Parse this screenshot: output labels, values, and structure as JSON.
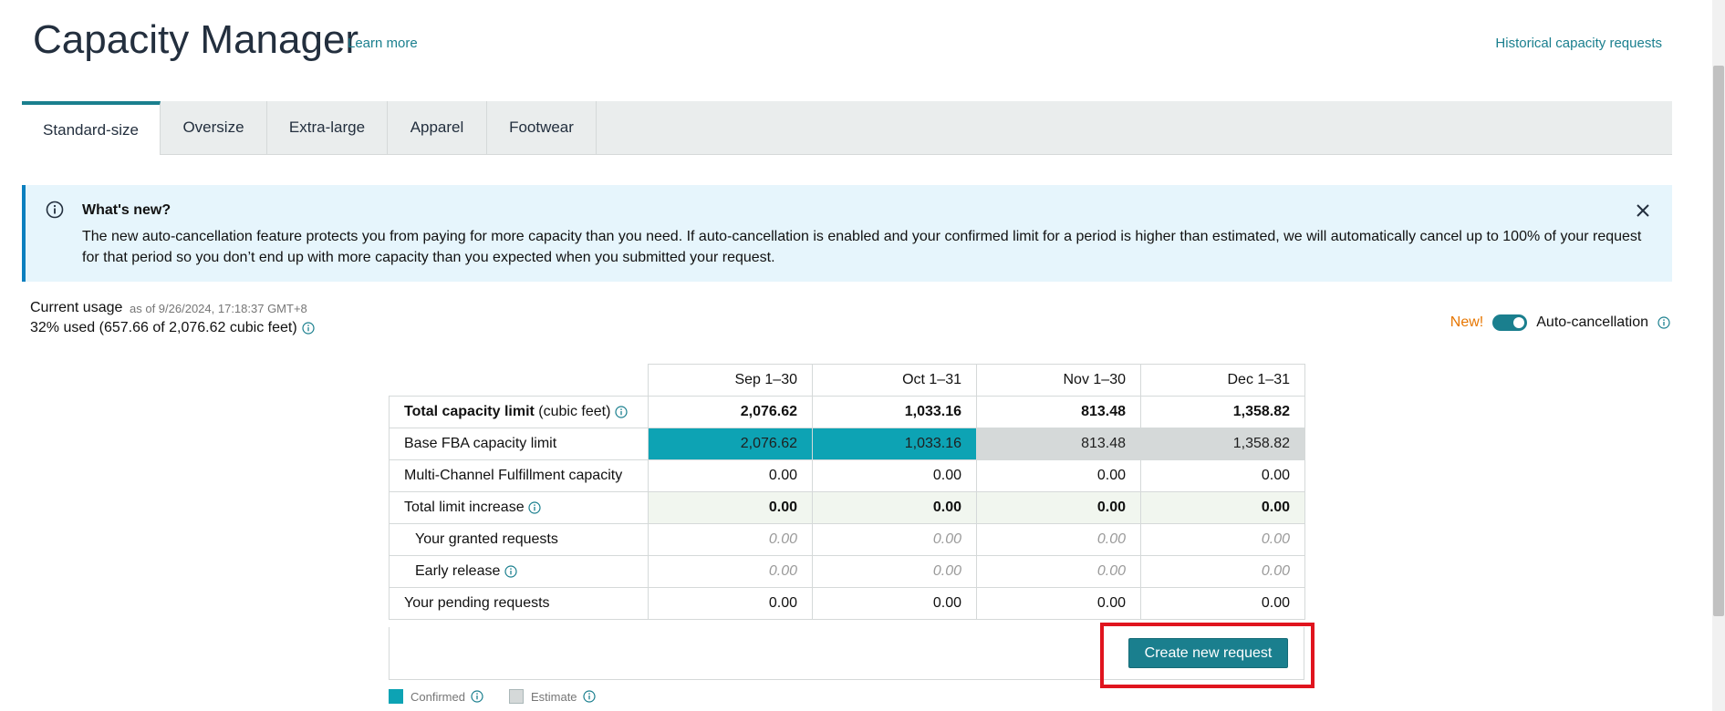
{
  "header": {
    "title": "Capacity Manager",
    "learn_more": "Learn more",
    "historical": "Historical capacity requests"
  },
  "tabs": [
    {
      "label": "Standard-size",
      "active": true
    },
    {
      "label": "Oversize"
    },
    {
      "label": "Extra-large"
    },
    {
      "label": "Apparel"
    },
    {
      "label": "Footwear"
    }
  ],
  "banner": {
    "title": "What's new?",
    "text": "The new auto-cancellation feature protects you from paying for more capacity than you need. If auto-cancellation is enabled and your confirmed limit for a period is higher than estimated, we will automatically cancel up to 100% of your request for that period so you don’t end up with more capacity than you expected when you submitted your request."
  },
  "usage": {
    "label": "Current usage",
    "as_of": "as of 9/26/2024, 17:18:37 GMT+8",
    "value": "32% used (657.66 of 2,076.62 cubic feet)"
  },
  "auto_cancel": {
    "new_badge": "New!",
    "label": "Auto-cancellation",
    "enabled": true
  },
  "table": {
    "columns": [
      "Sep 1–30",
      "Oct 1–31",
      "Nov 1–30",
      "Dec 1–31"
    ],
    "total_capacity": {
      "label_bold": "Total capacity limit",
      "label_unit": " (cubic feet)",
      "values": [
        "2,076.62",
        "1,033.16",
        "813.48",
        "1,358.82"
      ]
    },
    "base_fba": {
      "label": "Base FBA capacity limit",
      "values": [
        "2,076.62",
        "1,033.16",
        "813.48",
        "1,358.82"
      ]
    },
    "mcf": {
      "label": "Multi-Channel Fulfillment capacity",
      "values": [
        "0.00",
        "0.00",
        "0.00",
        "0.00"
      ]
    },
    "total_increase": {
      "label": "Total limit increase",
      "values": [
        "0.00",
        "0.00",
        "0.00",
        "0.00"
      ]
    },
    "granted": {
      "label": "Your granted requests",
      "values": [
        "0.00",
        "0.00",
        "0.00",
        "0.00"
      ]
    },
    "early_release": {
      "label": "Early release",
      "values": [
        "0.00",
        "0.00",
        "0.00",
        "0.00"
      ]
    },
    "pending": {
      "label": "Your pending requests",
      "values": [
        "0.00",
        "0.00",
        "0.00",
        "0.00"
      ]
    }
  },
  "create_button": "Create new request",
  "legend": {
    "confirmed": "Confirmed",
    "estimate": "Estimate"
  },
  "colors": {
    "accent": "#1a7f8e",
    "confirmed": "#0da3b4",
    "estimate": "#d5d9d9",
    "highlight": "#e0141e",
    "new_badge": "#e77600"
  }
}
